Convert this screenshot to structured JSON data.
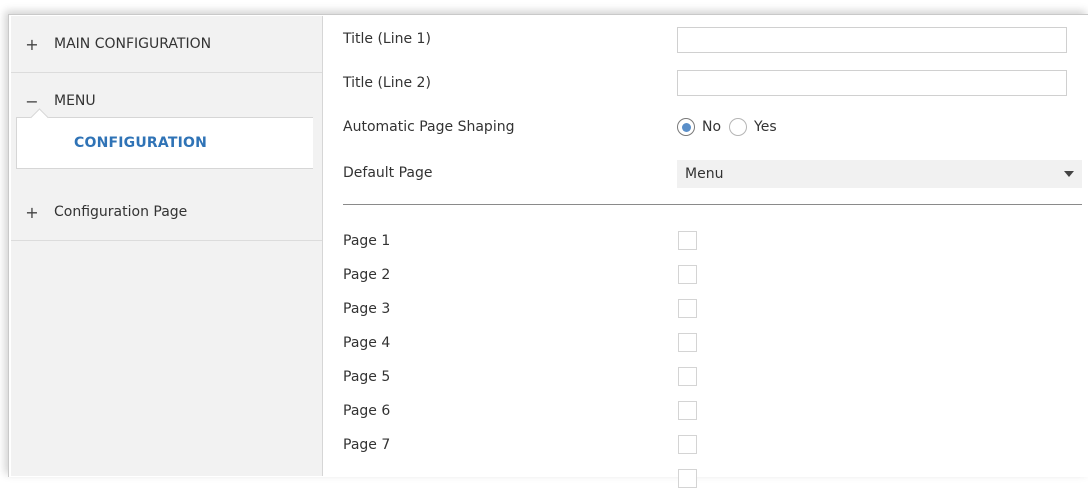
{
  "sidebar": {
    "items": [
      {
        "symbol": "+",
        "label": "MAIN CONFIGURATION"
      },
      {
        "symbol": "−",
        "label": "MENU"
      },
      {
        "symbol": "+",
        "label": "Configuration Page"
      }
    ],
    "sub_item": {
      "label": "CONFIGURATION"
    },
    "accent_color": "#2f73b6"
  },
  "form": {
    "title_line1": {
      "label": "Title (Line 1)",
      "value": ""
    },
    "title_line2": {
      "label": "Title (Line 2)",
      "value": ""
    },
    "auto_shaping": {
      "label": "Automatic Page Shaping",
      "options": [
        "No",
        "Yes"
      ],
      "selected": "No"
    },
    "default_page": {
      "label": "Default Page",
      "value": "Menu"
    }
  },
  "pages": [
    {
      "label": "Page 1",
      "checked": false
    },
    {
      "label": "Page 2",
      "checked": false
    },
    {
      "label": "Page 3",
      "checked": false
    },
    {
      "label": "Page 4",
      "checked": false
    },
    {
      "label": "Page 5",
      "checked": false
    },
    {
      "label": "Page 6",
      "checked": false
    },
    {
      "label": "Page 7",
      "checked": false
    }
  ]
}
